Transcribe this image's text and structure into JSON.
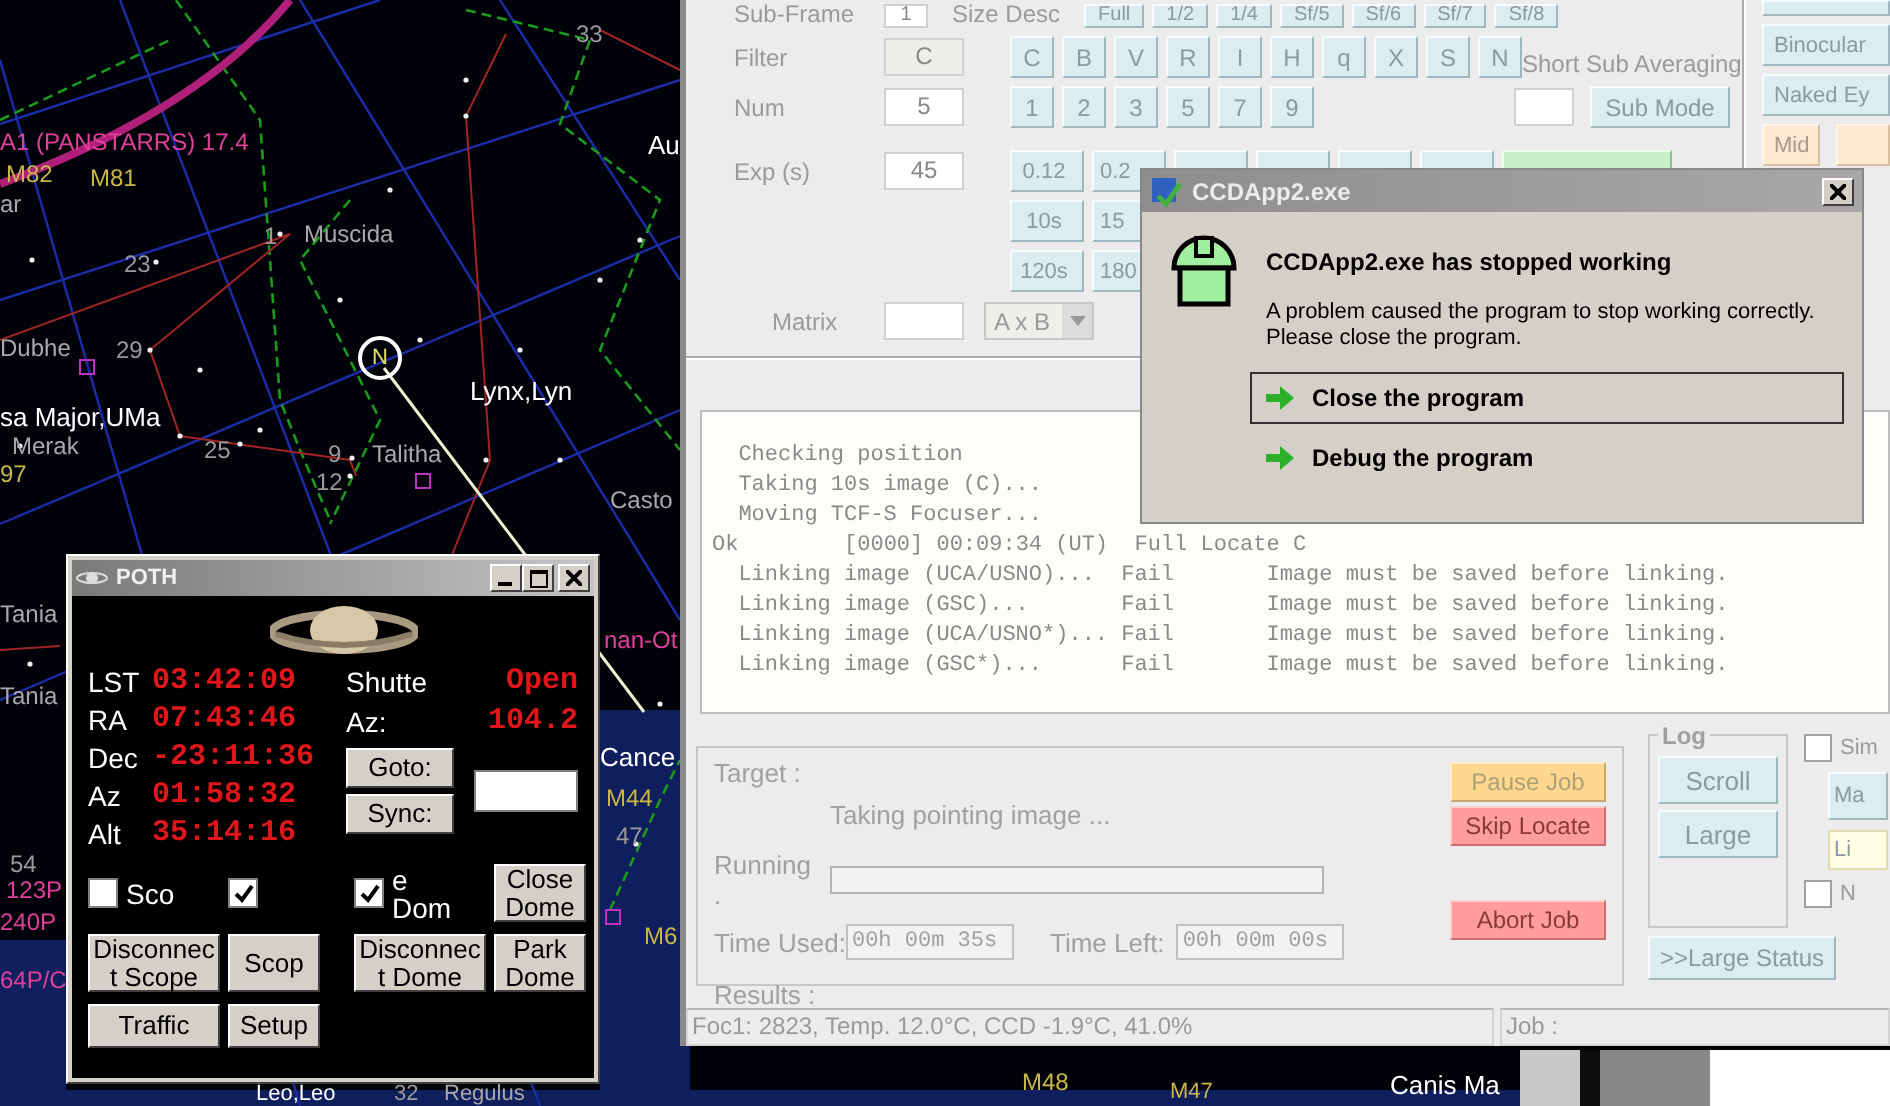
{
  "sky_chart": {
    "labels": [
      {
        "text": "A1 (PANSTARRS) 17.4",
        "kind": "comet"
      },
      {
        "text": "M82",
        "kind": "deep_sky"
      },
      {
        "text": "M81",
        "kind": "deep_sky"
      },
      {
        "text": "ar",
        "kind": "star"
      },
      {
        "text": "1",
        "kind": "number"
      },
      {
        "text": "Muscida",
        "kind": "star"
      },
      {
        "text": "23",
        "kind": "number"
      },
      {
        "text": "Dubhe",
        "kind": "star"
      },
      {
        "text": "29",
        "kind": "number"
      },
      {
        "text": "Lynx,Lyn",
        "kind": "constellation"
      },
      {
        "text": "sa Major,UMa",
        "kind": "constellation"
      },
      {
        "text": "Merak",
        "kind": "star"
      },
      {
        "text": "25",
        "kind": "number"
      },
      {
        "text": "9",
        "kind": "number"
      },
      {
        "text": "Talitha",
        "kind": "star"
      },
      {
        "text": "97",
        "kind": "deep_sky"
      },
      {
        "text": "12",
        "kind": "number"
      },
      {
        "text": "33",
        "kind": "number"
      },
      {
        "text": "Au",
        "kind": "constellation"
      },
      {
        "text": "Casto",
        "kind": "star"
      },
      {
        "text": "Tania",
        "kind": "star"
      },
      {
        "text": "Tania",
        "kind": "star"
      },
      {
        "text": "54",
        "kind": "number"
      },
      {
        "text": "123P",
        "kind": "comet"
      },
      {
        "text": "240P",
        "kind": "comet"
      },
      {
        "text": "64P/C",
        "kind": "comet"
      },
      {
        "text": "nan-Ot",
        "kind": "comet"
      },
      {
        "text": "Cance",
        "kind": "constellation"
      },
      {
        "text": "M44",
        "kind": "deep_sky"
      },
      {
        "text": "47",
        "kind": "number"
      },
      {
        "text": "M6",
        "kind": "deep_sky"
      },
      {
        "text": "Leo,Leo",
        "kind": "constellation"
      },
      {
        "text": "32",
        "kind": "number"
      },
      {
        "text": "Regulus",
        "kind": "star"
      },
      {
        "text": "M48",
        "kind": "deep_sky"
      },
      {
        "text": "M47",
        "kind": "deep_sky"
      },
      {
        "text": "Canis Ma",
        "kind": "constellation"
      },
      {
        "text": "N",
        "kind": "marker"
      }
    ]
  },
  "poth_window": {
    "title": "POTH",
    "readouts": [
      {
        "label": "LST",
        "value": "03:42:09"
      },
      {
        "label": "RA",
        "value": "07:43:46"
      },
      {
        "label": "Dec",
        "value": "-23:11:36"
      },
      {
        "label": "Az",
        "value": "01:58:32"
      },
      {
        "label": "Alt",
        "value": "35:14:16"
      }
    ],
    "dome_readouts": [
      {
        "label": "Shutte",
        "value": "Open"
      },
      {
        "label": "Az:",
        "value": "104.2"
      }
    ],
    "goto_button": "Goto:",
    "sync_button": "Sync:",
    "checkboxes": [
      {
        "label": "Sco",
        "checked": false
      },
      {
        "checked": true
      },
      {
        "label": "e Dom",
        "checked": true
      }
    ],
    "close_dome_button": "Close Dome",
    "buttons": [
      "Disconnect Scope",
      "Scop",
      "Disconnect Dome",
      "Park Dome",
      "Traffic",
      "Setup"
    ]
  },
  "ccd_window": {
    "subframe": {
      "label": "Sub-Frame",
      "value": "1",
      "size_label": "Size Desc",
      "buttons": [
        "Full",
        "1/2",
        "1/4",
        "Sf/5",
        "Sf/6",
        "Sf/7",
        "Sf/8"
      ]
    },
    "filter": {
      "label": "Filter",
      "value": "C",
      "buttons": [
        "C",
        "B",
        "V",
        "R",
        "I",
        "H",
        "q",
        "X",
        "S",
        "N"
      ]
    },
    "short_sub": {
      "label": "Short Sub Averaging",
      "button": "Sub Mode"
    },
    "num": {
      "label": "Num",
      "value": "5",
      "buttons": [
        "1",
        "2",
        "3",
        "5",
        "7",
        "9"
      ]
    },
    "exposure": {
      "label": "Exp (s)",
      "value": "45",
      "rows": [
        [
          "0.12",
          "0.2"
        ],
        [
          "10s",
          "15"
        ],
        [
          "120s",
          "180"
        ]
      ]
    },
    "matrix": {
      "label": "Matrix",
      "dropdown": "A x B"
    },
    "side_buttons": [
      {
        "text": "Binocular",
        "kind": "plain"
      },
      {
        "text": "Naked Ey",
        "kind": "plain"
      },
      {
        "text": "Mid",
        "kind": "accent"
      }
    ],
    "log_lines": [
      {
        "kind": "step",
        "text": "Checking position"
      },
      {
        "kind": "step",
        "text": "Taking 10s image (C)..."
      },
      {
        "kind": "step",
        "text": "Moving TCF-S Focuser..."
      },
      {
        "kind": "result",
        "text": "Ok        [0000] 00:09:34 (UT)  Full Locate C"
      },
      {
        "kind": "step",
        "text": "Linking image (UCA/USNO)...",
        "status": "Fail",
        "note": "Image must be saved before linking."
      },
      {
        "kind": "step",
        "text": "Linking image (GSC)...",
        "status": "Fail",
        "note": "Image must be saved before linking."
      },
      {
        "kind": "step",
        "text": "Linking image (UCA/USNO*)...",
        "status": "Fail",
        "note": "Image must be saved before linking."
      },
      {
        "kind": "step",
        "text": "Linking image (GSC*)...",
        "status": "Fail",
        "note": "Image must be saved before linking."
      }
    ],
    "job": {
      "target_label": "Target :",
      "status": "Taking pointing image ...",
      "running_label": "Running .",
      "progress": {
        "level": 0
      },
      "time_used_label": "Time Used:",
      "time_used": "00h 00m 35s",
      "time_left_label": "Time Left:",
      "time_left": "00h 00m 00s",
      "results_label": "Results :"
    },
    "job_buttons": [
      {
        "text": "Pause Job",
        "kind": "pause"
      },
      {
        "text": "Skip Locate",
        "kind": "stop"
      },
      {
        "text": "Abort Job",
        "kind": "stop"
      }
    ],
    "log_group": {
      "title": "Log",
      "buttons": [
        "Scroll",
        "Large"
      ]
    },
    "large_status_button": ">>Large Status",
    "side_controls": [
      {
        "kind": "checkbox",
        "label": "Sim",
        "checked": false
      },
      {
        "kind": "button",
        "label": "Ma"
      },
      {
        "kind": "highlight",
        "label": "Li"
      },
      {
        "kind": "checkbox",
        "label": "N",
        "checked": false
      }
    ],
    "status_bar": [
      "Foc1: 2823, Temp. 12.0°C, CCD -1.9°C, 41.0%",
      "Job :"
    ]
  },
  "error_dialog": {
    "title": "CCDApp2.exe",
    "heading": "CCDApp2.exe has stopped working",
    "message": "A problem caused the program to stop working correctly.\nPlease close the program.",
    "options": [
      {
        "label": "Close the program",
        "selected": true
      },
      {
        "label": "Debug the program",
        "selected": false
      }
    ]
  }
}
